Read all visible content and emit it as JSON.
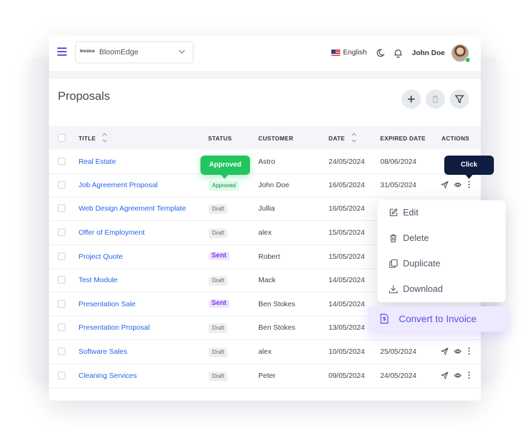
{
  "header": {
    "organization": "BloomEdge",
    "org_logo_text": "Invoice",
    "language": "English",
    "user_name": "John Doe"
  },
  "page": {
    "title": "Proposals"
  },
  "table": {
    "columns": {
      "title": "TITLE",
      "status": "STATUS",
      "customer": "CUSTOMER",
      "date": "DATE",
      "expired_date": "EXPIRED DATE",
      "actions": "ACTIONS"
    },
    "rows": [
      {
        "title": "Real Estate",
        "status": "Approved",
        "customer": "Astro",
        "date": "24/05/2024",
        "expired": "08/06/2024"
      },
      {
        "title": "Job Agreement Proposal",
        "status": "Approved",
        "customer": "John Doe",
        "date": "16/05/2024",
        "expired": "31/05/2024"
      },
      {
        "title": "Web Design Agreement Template",
        "status": "Draft",
        "customer": "Jullia",
        "date": "16/05/2024",
        "expired": ""
      },
      {
        "title": "Offer of Employment",
        "status": "Draft",
        "customer": "alex",
        "date": "15/05/2024",
        "expired": ""
      },
      {
        "title": "Project Quote",
        "status": "Sent",
        "customer": "Robert",
        "date": "15/05/2024",
        "expired": ""
      },
      {
        "title": "Test Module",
        "status": "Draft",
        "customer": "Mack",
        "date": "14/05/2024",
        "expired": ""
      },
      {
        "title": "Presentation Sale",
        "status": "Sent",
        "customer": "Ben Stokes",
        "date": "14/05/2024",
        "expired": ""
      },
      {
        "title": "Presentation Proposal",
        "status": "Draft",
        "customer": "Ben Stokes",
        "date": "13/05/2024",
        "expired": ""
      },
      {
        "title": "Software Sales",
        "status": "Draft",
        "customer": "alex",
        "date": "10/05/2024",
        "expired": "25/05/2024"
      },
      {
        "title": "Cleaning Services",
        "status": "Draft",
        "customer": "Peter",
        "date": "09/05/2024",
        "expired": "24/05/2024"
      }
    ]
  },
  "tooltips": {
    "approved": "Approved",
    "click": "Click"
  },
  "action_menu": {
    "edit": "Edit",
    "delete": "Delete",
    "duplicate": "Duplicate",
    "download": "Download",
    "convert": "Convert to Invoice"
  },
  "colors": {
    "accent": "#5b4fe0",
    "link": "#2563eb",
    "approved": "#22c55e",
    "sent": "#7c3aed",
    "tooltip_dark": "#0f1d40"
  }
}
